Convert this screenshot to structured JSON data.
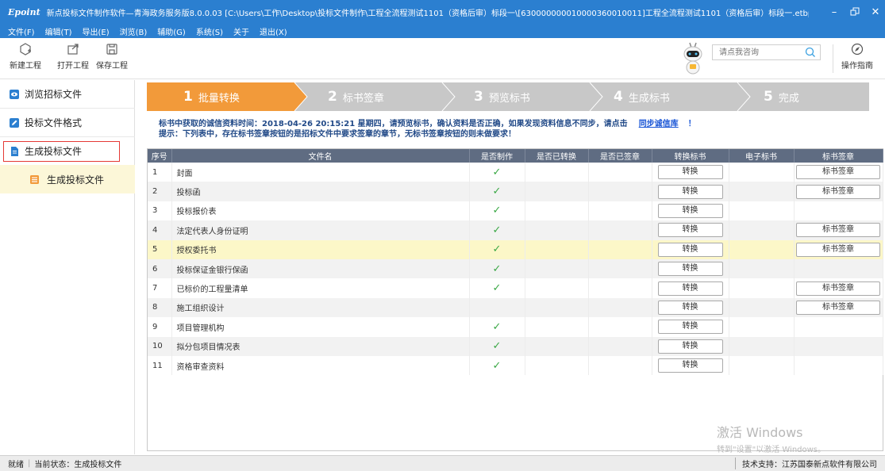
{
  "window": {
    "logo": "Epoint",
    "title": "新点投标文件制作软件—青海政务服务版8.0.0.03    [C:\\Users\\工作\\Desktop\\投标文件制作\\工程全流程测试1101（资格后审）标段一\\[630000000010000360010011]工程全流程测试1101（资格后审）标段一.etbp]"
  },
  "menu": [
    "文件(F)",
    "编辑(T)",
    "导出(E)",
    "浏览(B)",
    "辅助(G)",
    "系统(S)",
    "关于",
    "退出(X)"
  ],
  "toolbar": {
    "new": "新建工程",
    "open": "打开工程",
    "save": "保存工程",
    "search_placeholder": "请点我咨询",
    "guide": "操作指南"
  },
  "sidebar": {
    "items": [
      {
        "label": "浏览招标文件",
        "icon": "eye-icon"
      },
      {
        "label": "投标文件格式",
        "icon": "pencil-icon"
      },
      {
        "label": "生成投标文件",
        "icon": "document-icon"
      }
    ],
    "sub": {
      "label": "生成投标文件",
      "icon": "list-icon"
    }
  },
  "steps": [
    {
      "num": "1",
      "label": "批量转换",
      "active": true
    },
    {
      "num": "2",
      "label": "标书签章",
      "active": false
    },
    {
      "num": "3",
      "label": "预览标书",
      "active": false
    },
    {
      "num": "4",
      "label": "生成标书",
      "active": false
    },
    {
      "num": "5",
      "label": "完成",
      "active": false
    }
  ],
  "info": {
    "line1": "标书中获取的诚信资料时间：2018-04-26 20:15:21 星期四，请预览标书，确认资料是否正确，如果发现资料信息不同步，请点击",
    "link": "同步诚信库",
    "bang": "！",
    "line2": "提示：下列表中，存在标书签章按钮的是招标文件中要求签章的章节，无标书签章按钮的则未做要求！"
  },
  "table": {
    "headers": [
      "序号",
      "文件名",
      "是否制作",
      "是否已转换",
      "是否已签章",
      "转换标书",
      "电子标书",
      "标书签章"
    ],
    "convert_label": "转换",
    "sign_label": "标书签章",
    "rows": [
      {
        "no": "1",
        "name": "封面",
        "made": true,
        "sign": true,
        "highlight": false
      },
      {
        "no": "2",
        "name": "投标函",
        "made": true,
        "sign": true,
        "highlight": false
      },
      {
        "no": "3",
        "name": "投标报价表",
        "made": true,
        "sign": false,
        "highlight": false
      },
      {
        "no": "4",
        "name": "法定代表人身份证明",
        "made": true,
        "sign": true,
        "highlight": false
      },
      {
        "no": "5",
        "name": "授权委托书",
        "made": true,
        "sign": true,
        "highlight": true
      },
      {
        "no": "6",
        "name": "投标保证金银行保函",
        "made": true,
        "sign": false,
        "highlight": false
      },
      {
        "no": "7",
        "name": "已标价的工程量清单",
        "made": true,
        "sign": true,
        "highlight": false
      },
      {
        "no": "8",
        "name": "施工组织设计",
        "made": false,
        "sign": true,
        "highlight": false
      },
      {
        "no": "9",
        "name": "项目管理机构",
        "made": true,
        "sign": false,
        "highlight": false
      },
      {
        "no": "10",
        "name": "拟分包项目情况表",
        "made": true,
        "sign": false,
        "highlight": false
      },
      {
        "no": "11",
        "name": "资格审查资料",
        "made": true,
        "sign": false,
        "highlight": false
      }
    ]
  },
  "watermark": {
    "line1": "激活 Windows",
    "line2": "转到\"设置\"以激活 Windows。"
  },
  "status": {
    "ready": "就绪",
    "state": "当前状态：生成投标文件",
    "support": "技术支持：江苏国泰新点软件有限公司"
  },
  "colors": {
    "titlebar": "#2b7fd0",
    "step_active": "#f29a3a",
    "step_inactive": "#c8c8c8",
    "table_header": "#5f6c82",
    "highlight_row": "#fcf7c8",
    "check": "#3aa845"
  }
}
